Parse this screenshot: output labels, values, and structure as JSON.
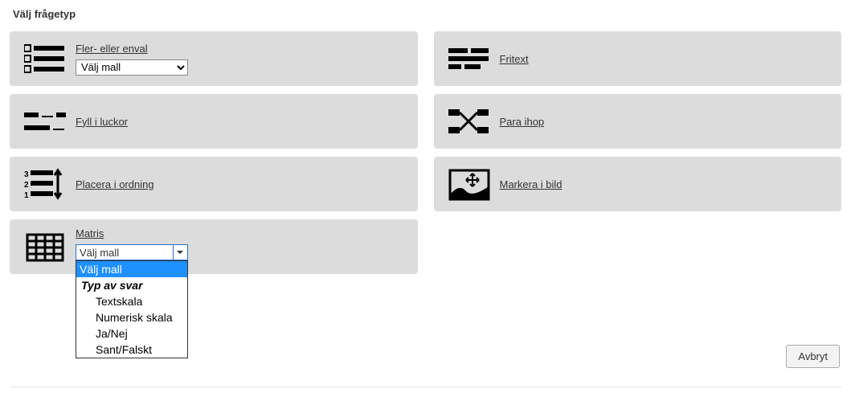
{
  "heading": "Välj frågetyp",
  "cards": {
    "multi": {
      "label": "Fler- eller enval",
      "select_placeholder": "Välj mall"
    },
    "fill": {
      "label": "Fyll i luckor"
    },
    "order": {
      "label": "Placera i ordning"
    },
    "matrix": {
      "label": "Matris"
    },
    "free": {
      "label": "Fritext"
    },
    "pair": {
      "label": "Para ihop"
    },
    "image": {
      "label": "Markera i bild"
    }
  },
  "matrix_dropdown": {
    "button_label": "Välj mall",
    "options": [
      {
        "label": "Välj mall",
        "selected": true
      },
      {
        "label": "Typ av svar",
        "group": true
      },
      {
        "label": "Textskala",
        "child": true
      },
      {
        "label": "Numerisk skala",
        "child": true
      },
      {
        "label": "Ja/Nej",
        "child": true
      },
      {
        "label": "Sant/Falskt",
        "child": true
      }
    ]
  },
  "footer": {
    "cancel_label": "Avbryt"
  }
}
